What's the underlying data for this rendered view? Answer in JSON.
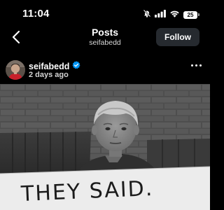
{
  "status_bar": {
    "time": "11:04",
    "battery_level": "25",
    "icons": [
      "bell-slash-icon",
      "signal-icon",
      "wifi-icon",
      "battery-icon"
    ]
  },
  "nav": {
    "back_icon": "chevron-left-icon",
    "title": "Posts",
    "subtitle": "seifabedd",
    "follow_label": "Follow"
  },
  "post": {
    "username": "seifabedd",
    "verified": true,
    "timestamp": "2 days ago",
    "more_icon": "more-horizontal-icon",
    "image": {
      "sign_text": "THEY SAID."
    }
  },
  "colors": {
    "background": "#000000",
    "follow_button": "#262a2f",
    "verified_badge": "#0095f6"
  }
}
